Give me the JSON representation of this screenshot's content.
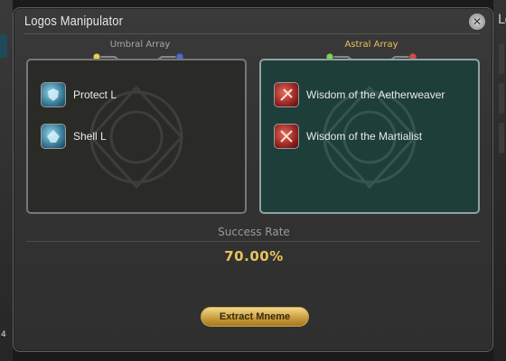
{
  "window": {
    "title": "Logos Manipulator"
  },
  "umbral": {
    "label": "Umbral Array",
    "items": [
      {
        "label": "Protect L",
        "icon": "protect-icon"
      },
      {
        "label": "Shell L",
        "icon": "shell-icon"
      }
    ],
    "colors": {
      "label": "#a8a8a8",
      "panel": "#2a2a26"
    }
  },
  "astral": {
    "label": "Astral Array",
    "items": [
      {
        "label": "Wisdom of the Aetherweaver",
        "icon": "aetherweaver-icon"
      },
      {
        "label": "Wisdom of the Martialist",
        "icon": "martialist-icon"
      }
    ],
    "colors": {
      "label": "#e8c25a",
      "panel": "#1e3e3a"
    }
  },
  "success": {
    "label": "Success Rate",
    "value": "70.00%"
  },
  "actions": {
    "extract_label": "Extract Mneme"
  },
  "side": {
    "left_number": "4",
    "right_text": "Lo"
  }
}
